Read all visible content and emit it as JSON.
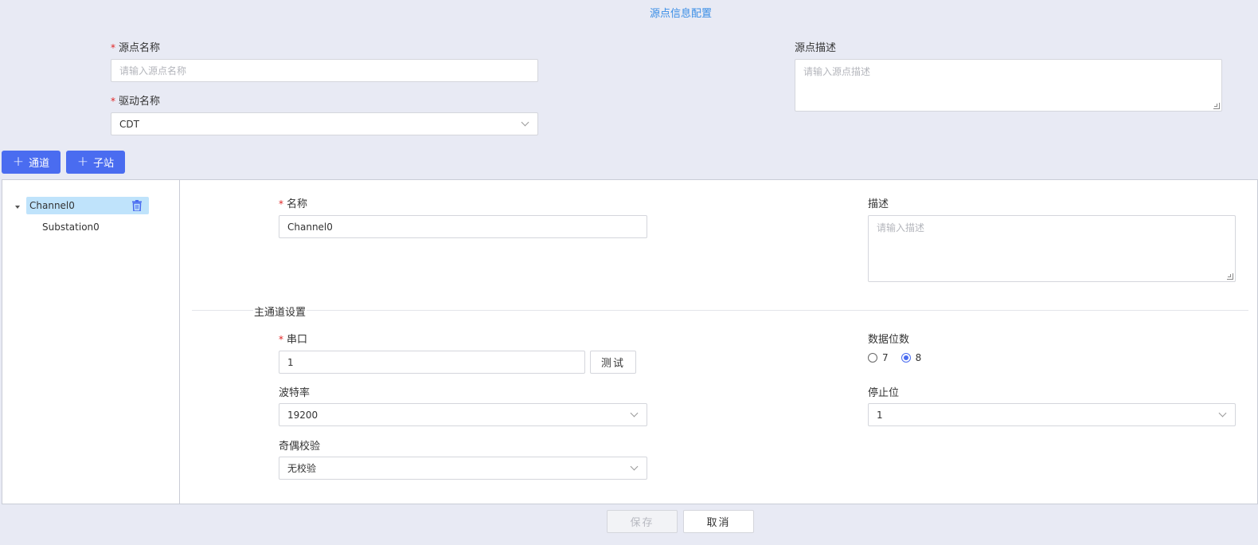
{
  "page": {
    "title": "源点信息配置"
  },
  "source_form": {
    "name": {
      "label": "源点名称",
      "placeholder": "请输入源点名称"
    },
    "driver": {
      "label": "驱动名称",
      "value": "CDT"
    },
    "description": {
      "label": "源点描述",
      "placeholder": "请输入源点描述"
    }
  },
  "toolbar": {
    "add_channel": "通道",
    "add_substation": "子站"
  },
  "tree": {
    "channel": "Channel0",
    "substation": "Substation0"
  },
  "channel_form": {
    "name": {
      "label": "名称",
      "value": "Channel0"
    },
    "description": {
      "label": "描述",
      "placeholder": "请输入描述"
    },
    "section_title": "主通道设置",
    "serial": {
      "label": "串口",
      "value": "1",
      "test_label": "测试"
    },
    "data_bits": {
      "label": "数据位数",
      "options": [
        "7",
        "8"
      ],
      "selected": "8"
    },
    "baud_rate": {
      "label": "波特率",
      "value": "19200"
    },
    "stop_bits": {
      "label": "停止位",
      "value": "1"
    },
    "parity": {
      "label": "奇偶校验",
      "value": "无校验"
    }
  },
  "footer": {
    "save_label": "保存",
    "cancel_label": "取消"
  },
  "colors": {
    "primary": "#4a6cf0",
    "title": "#3a8ee6",
    "selected_node": "#bfe3fb",
    "required": "#e02424"
  }
}
